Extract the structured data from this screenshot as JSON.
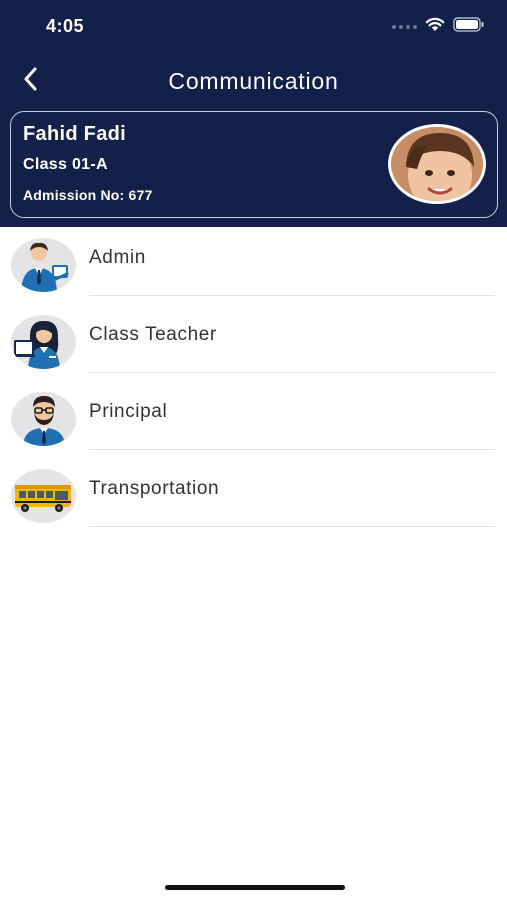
{
  "status_bar": {
    "time": "4:05"
  },
  "nav": {
    "title": "Communication",
    "back_icon": "chevron-left-icon"
  },
  "student": {
    "name": "Fahid Fadi",
    "class": "Class 01-A",
    "admission": "Admission No: 677"
  },
  "contacts": [
    {
      "label": "Admin",
      "icon": "admin-icon"
    },
    {
      "label": "Class Teacher",
      "icon": "teacher-icon"
    },
    {
      "label": "Principal",
      "icon": "principal-icon"
    },
    {
      "label": "Transportation",
      "icon": "bus-icon"
    }
  ],
  "colors": {
    "header_bg": "#13214a",
    "card_border": "#c9cedb",
    "text_dark": "#333333"
  }
}
